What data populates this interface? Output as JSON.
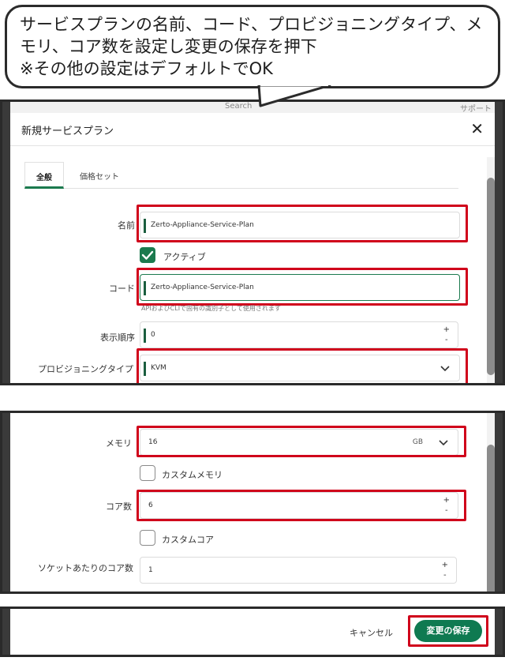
{
  "callout": {
    "line1": "サービスプランの名前、コード、プロビジョニングタイプ、メ",
    "line2": "モリ、コア数を設定し変更の保存を押下",
    "line3": "※その他の設定はデフォルトでOK"
  },
  "background": {
    "search_placeholder": "Search",
    "support": "サポート"
  },
  "modal": {
    "title": "新規サービスプラン",
    "close": "✕",
    "tabs": [
      {
        "label": "全般"
      },
      {
        "label": "価格セット"
      }
    ]
  },
  "form": {
    "name": {
      "label": "名前",
      "value": "Zerto-Appliance-Service-Plan"
    },
    "active": {
      "label": "アクティブ",
      "checked": true
    },
    "code": {
      "label": "コード",
      "value": "Zerto-Appliance-Service-Plan",
      "hint": "APIおよびCLIで固有の識別子として使用されます"
    },
    "display_order": {
      "label": "表示順序",
      "value": "0"
    },
    "provisioning_type": {
      "label": "プロビジョニングタイプ",
      "value": "KVM"
    },
    "memory": {
      "label": "メモリ",
      "value": "16",
      "unit": "GB"
    },
    "custom_memory": {
      "label": "カスタムメモリ",
      "checked": false
    },
    "core_count": {
      "label": "コア数",
      "value": "6"
    },
    "custom_core": {
      "label": "カスタムコア",
      "checked": false
    },
    "cores_per_socket": {
      "label": "ソケットあたりのコア数",
      "value": "1"
    },
    "stepper_plus": "+",
    "stepper_minus": "-"
  },
  "footer": {
    "cancel": "キャンセル",
    "save": "変更の保存"
  },
  "colors": {
    "accent": "#1b7a4e",
    "highlight": "#d0021b"
  }
}
